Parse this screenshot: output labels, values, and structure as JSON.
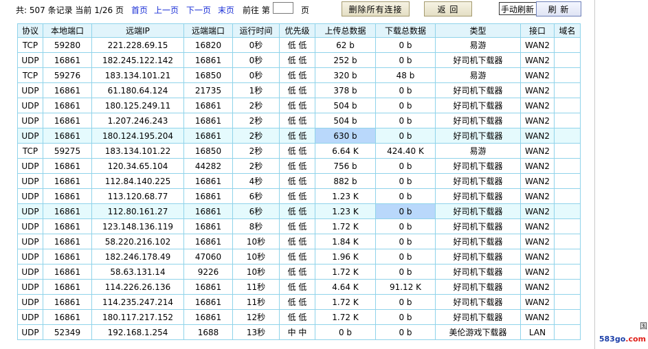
{
  "toolbar": {
    "record_prefix": "共: ",
    "record_count": "507",
    "record_suffix": " 条记录 当前 ",
    "page_current": "1/26",
    "page_suffix": " 页",
    "first_page": "首页",
    "prev_page": "上一页",
    "next_page": "下一页",
    "last_page": "末页",
    "goto_label": "前往 第",
    "goto_value": "",
    "goto_suffix": "页",
    "delete_all_button": "删除所有连接",
    "back_button": "返 回",
    "refresh_mode": "手动刷新",
    "refresh_button": "刷 新"
  },
  "table": {
    "headers": [
      "协议",
      "本地端口",
      "远端IP",
      "远端端口",
      "运行时间",
      "优先级",
      "上传总数据",
      "下载总数据",
      "类型",
      "接口",
      "域名"
    ],
    "rows": [
      [
        "TCP",
        "59280",
        "221.228.69.15",
        "16820",
        "0秒",
        "低 低",
        "62 b",
        "0 b",
        "易游",
        "WAN2",
        ""
      ],
      [
        "UDP",
        "16861",
        "182.245.122.142",
        "16861",
        "0秒",
        "低 低",
        "252 b",
        "0 b",
        "好司机下载器",
        "WAN2",
        ""
      ],
      [
        "TCP",
        "59276",
        "183.134.101.21",
        "16850",
        "0秒",
        "低 低",
        "320 b",
        "48 b",
        "易游",
        "WAN2",
        ""
      ],
      [
        "UDP",
        "16861",
        "61.180.64.124",
        "21735",
        "1秒",
        "低 低",
        "378 b",
        "0 b",
        "好司机下载器",
        "WAN2",
        ""
      ],
      [
        "UDP",
        "16861",
        "180.125.249.11",
        "16861",
        "2秒",
        "低 低",
        "504 b",
        "0 b",
        "好司机下载器",
        "WAN2",
        ""
      ],
      [
        "UDP",
        "16861",
        "1.207.246.243",
        "16861",
        "2秒",
        "低 低",
        "504 b",
        "0 b",
        "好司机下载器",
        "WAN2",
        ""
      ],
      [
        "UDP",
        "16861",
        "180.124.195.204",
        "16861",
        "2秒",
        "低 低",
        "630 b",
        "0 b",
        "好司机下载器",
        "WAN2",
        ""
      ],
      [
        "TCP",
        "59275",
        "183.134.101.22",
        "16850",
        "2秒",
        "低 低",
        "6.64 K",
        "424.40 K",
        "易游",
        "WAN2",
        ""
      ],
      [
        "UDP",
        "16861",
        "120.34.65.104",
        "44282",
        "2秒",
        "低 低",
        "756 b",
        "0 b",
        "好司机下载器",
        "WAN2",
        ""
      ],
      [
        "UDP",
        "16861",
        "112.84.140.225",
        "16861",
        "4秒",
        "低 低",
        "882 b",
        "0 b",
        "好司机下载器",
        "WAN2",
        ""
      ],
      [
        "UDP",
        "16861",
        "113.120.68.77",
        "16861",
        "6秒",
        "低 低",
        "1.23 K",
        "0 b",
        "好司机下载器",
        "WAN2",
        ""
      ],
      [
        "UDP",
        "16861",
        "112.80.161.27",
        "16861",
        "6秒",
        "低 低",
        "1.23 K",
        "0 b",
        "好司机下载器",
        "WAN2",
        ""
      ],
      [
        "UDP",
        "16861",
        "123.148.136.119",
        "16861",
        "8秒",
        "低 低",
        "1.72 K",
        "0 b",
        "好司机下载器",
        "WAN2",
        ""
      ],
      [
        "UDP",
        "16861",
        "58.220.216.102",
        "16861",
        "10秒",
        "低 低",
        "1.84 K",
        "0 b",
        "好司机下载器",
        "WAN2",
        ""
      ],
      [
        "UDP",
        "16861",
        "182.246.178.49",
        "47060",
        "10秒",
        "低 低",
        "1.96 K",
        "0 b",
        "好司机下载器",
        "WAN2",
        ""
      ],
      [
        "UDP",
        "16861",
        "58.63.131.14",
        "9226",
        "10秒",
        "低 低",
        "1.72 K",
        "0 b",
        "好司机下载器",
        "WAN2",
        ""
      ],
      [
        "UDP",
        "16861",
        "114.226.26.136",
        "16861",
        "11秒",
        "低 低",
        "4.64 K",
        "91.12 K",
        "好司机下载器",
        "WAN2",
        ""
      ],
      [
        "UDP",
        "16861",
        "114.235.247.214",
        "16861",
        "11秒",
        "低 低",
        "1.72 K",
        "0 b",
        "好司机下载器",
        "WAN2",
        ""
      ],
      [
        "UDP",
        "16861",
        "180.117.217.152",
        "16861",
        "12秒",
        "低 低",
        "1.72 K",
        "0 b",
        "好司机下载器",
        "WAN2",
        ""
      ],
      [
        "UDP",
        "52349",
        "192.168.1.254",
        "1688",
        "13秒",
        "中 中",
        "0 b",
        "0 b",
        "美伦游戏下载器",
        "LAN",
        ""
      ]
    ]
  },
  "highlight": {
    "rows": [
      6,
      11
    ],
    "cells": [
      [
        6,
        6
      ],
      [
        11,
        7
      ]
    ]
  },
  "side": {
    "edge_char": "国",
    "watermark_main": "583go",
    "watermark_accent": ".com"
  },
  "colors": {
    "link": "#1a2fd6",
    "grid_border": "#8fd3ea",
    "header_bg": "#e1f4fb",
    "row_highlight": "#e5fafd",
    "cell_highlight": "#b9d8fb"
  }
}
